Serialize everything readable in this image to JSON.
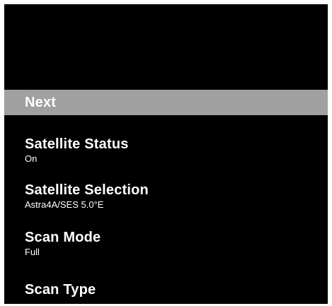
{
  "menu": {
    "selected": {
      "label": "Next"
    },
    "items": [
      {
        "label": "Satellite Status",
        "value": "On"
      },
      {
        "label": "Satellite Selection",
        "value": "Astra4A/SES 5.0°E"
      },
      {
        "label": "Scan Mode",
        "value": "Full"
      },
      {
        "label": "Scan Type",
        "value": ""
      }
    ]
  },
  "colors": {
    "background": "#000000",
    "highlight": "#a0a0a0",
    "text": "#ffffff"
  }
}
